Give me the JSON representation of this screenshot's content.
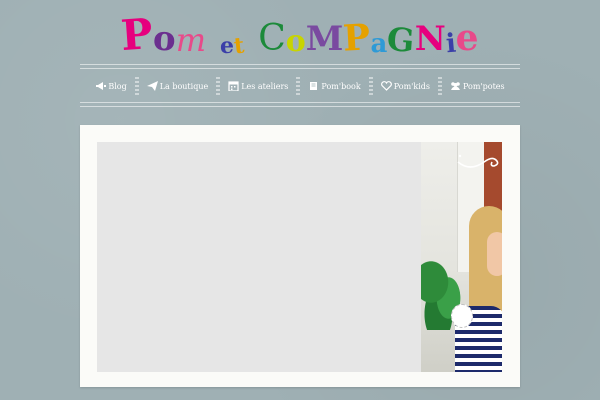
{
  "site": {
    "logo_letters": [
      "P",
      "o",
      "m",
      "e",
      "t",
      "C",
      "o",
      "M",
      "P",
      "a",
      "G",
      "N",
      "i",
      "e"
    ]
  },
  "nav": {
    "items": [
      {
        "label": "Blog",
        "icon": "megaphone-icon"
      },
      {
        "label": "La boutique",
        "icon": "paper-plane-icon"
      },
      {
        "label": "Les ateliers",
        "icon": "calendar-icon"
      },
      {
        "label": "Pom'book",
        "icon": "book-icon"
      },
      {
        "label": "Pom'kids",
        "icon": "heart-icon"
      },
      {
        "label": "Pom'potes",
        "icon": "users-icon"
      }
    ]
  },
  "colors": {
    "background": "#9fb0b4",
    "frame": "#fbfbf8",
    "placeholder": "#e6e6e6",
    "nav_text": "#ffffff"
  }
}
